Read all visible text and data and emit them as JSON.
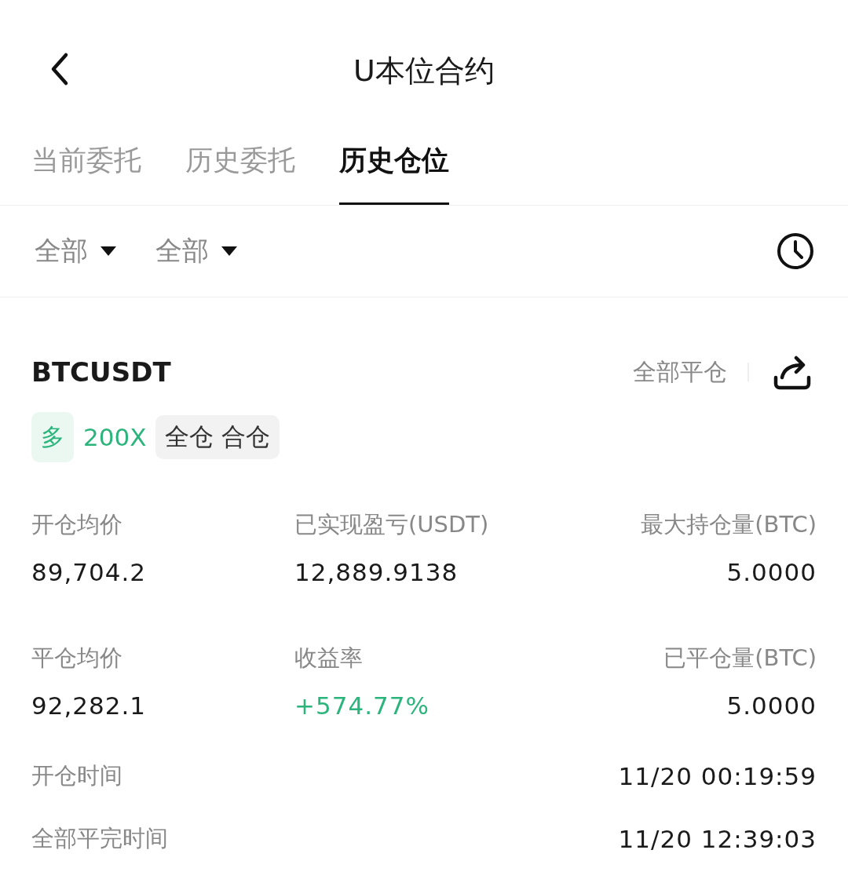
{
  "header": {
    "title": "U本位合约"
  },
  "tabs": [
    {
      "label": "当前委托",
      "selected": false
    },
    {
      "label": "历史委托",
      "selected": false
    },
    {
      "label": "历史仓位",
      "selected": true
    }
  ],
  "filters": [
    {
      "label": "全部"
    },
    {
      "label": "全部"
    }
  ],
  "position": {
    "symbol": "BTCUSDT",
    "close_all": "全部平仓",
    "side": "多",
    "leverage": "200X",
    "margin_mode": "全仓 合仓",
    "stats": [
      {
        "label": "开仓均价",
        "value": "89,704.2",
        "color": "#1a1a1a"
      },
      {
        "label": "已实现盈亏(USDT)",
        "value": "12,889.9138",
        "color": "#1a1a1a"
      },
      {
        "label": "最大持仓量(BTC)",
        "value": "5.0000",
        "color": "#1a1a1a"
      },
      {
        "label": "平仓均价",
        "value": "92,282.1",
        "color": "#1a1a1a"
      },
      {
        "label": "收益率",
        "value": "+574.77%",
        "color": "#2bb47c"
      },
      {
        "label": "已平仓量(BTC)",
        "value": "5.0000",
        "color": "#1a1a1a"
      }
    ],
    "times": [
      {
        "label": "开仓时间",
        "value": "11/20 00:19:59"
      },
      {
        "label": "全部平完时间",
        "value": "11/20 12:39:03"
      }
    ]
  }
}
